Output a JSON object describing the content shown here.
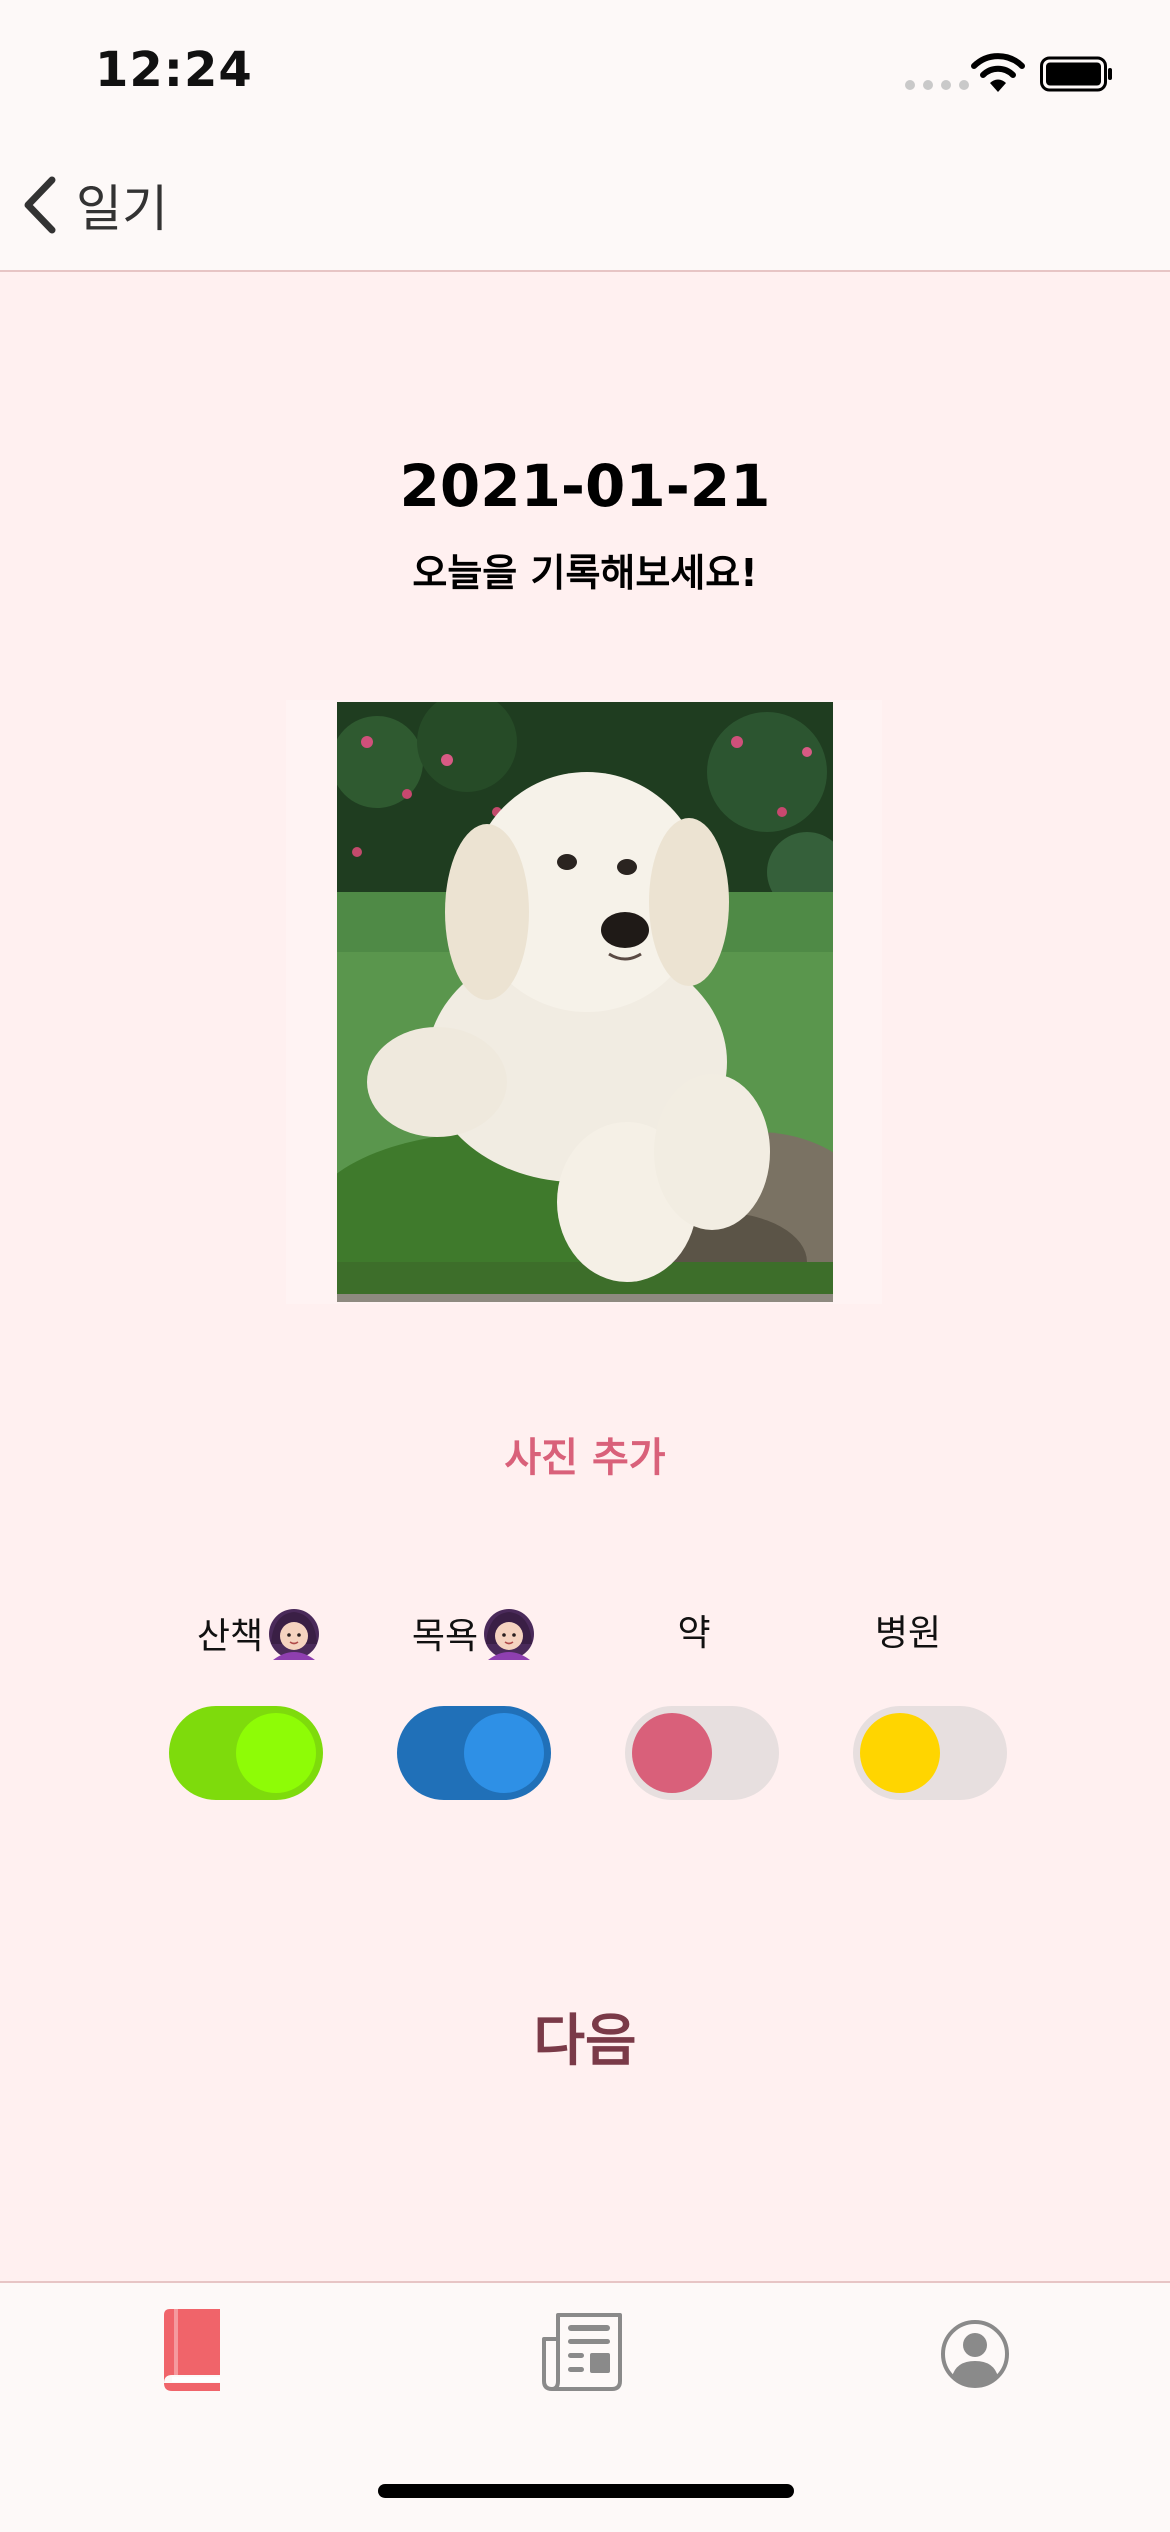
{
  "status_bar": {
    "time": "12:24"
  },
  "nav": {
    "back_label": "일기"
  },
  "entry": {
    "date": "2021-01-21",
    "prompt": "오늘을 기록해보세요!"
  },
  "photo": {
    "add_label": "사진 추가"
  },
  "activities": [
    {
      "label": "산책",
      "has_emoji": true,
      "on": true,
      "track_color": "#7edb0c",
      "knob_color": "#8efc06"
    },
    {
      "label": "목욕",
      "has_emoji": true,
      "on": true,
      "track_color": "#2070b8",
      "knob_color": "#2e90e6"
    },
    {
      "label": "약",
      "has_emoji": false,
      "on": false,
      "track_color": "#e7dfdf",
      "knob_color": "#d9607a"
    },
    {
      "label": "병원",
      "has_emoji": false,
      "on": false,
      "track_color": "#e7dfdf",
      "knob_color": "#ffd500"
    }
  ],
  "next_label": "다음",
  "tabs": [
    {
      "icon": "diary-book-icon",
      "selected": true,
      "color": "#f0646a"
    },
    {
      "icon": "newspaper-icon",
      "selected": false,
      "color": "#8a8a8a"
    },
    {
      "icon": "profile-icon",
      "selected": false,
      "color": "#8a8a8a"
    }
  ]
}
